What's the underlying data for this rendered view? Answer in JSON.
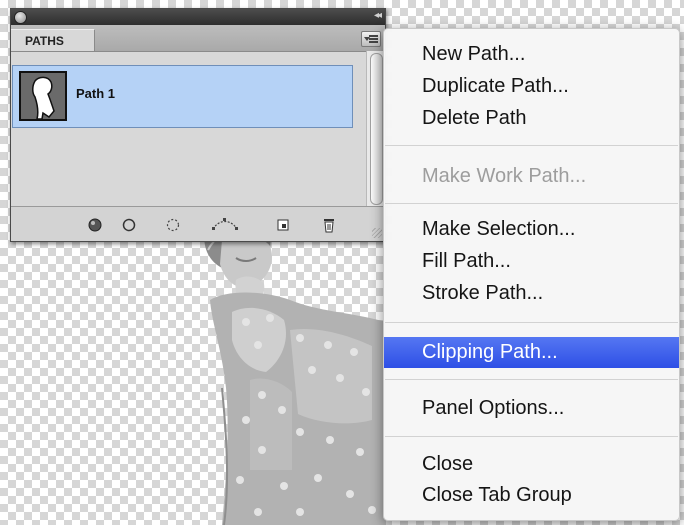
{
  "panel": {
    "tab_label": "PATHS",
    "collapse_glyph": "◂◂",
    "paths": [
      {
        "label": "Path 1",
        "selected": true
      }
    ],
    "footer_buttons": [
      {
        "icon": "fill-path-icon"
      },
      {
        "icon": "stroke-path-icon"
      },
      {
        "icon": "load-selection-icon"
      },
      {
        "icon": "make-work-path-icon"
      },
      {
        "icon": "new-path-icon"
      },
      {
        "icon": "delete-path-icon"
      }
    ]
  },
  "menu": {
    "items": [
      {
        "label": "New Path...",
        "disabled": false,
        "selected": false
      },
      {
        "label": "Duplicate Path...",
        "disabled": false,
        "selected": false
      },
      {
        "label": "Delete Path",
        "disabled": false,
        "selected": false
      },
      {
        "label": "Make Work Path...",
        "disabled": true,
        "selected": false
      },
      {
        "label": "Make Selection...",
        "disabled": false,
        "selected": false
      },
      {
        "label": "Fill Path...",
        "disabled": false,
        "selected": false
      },
      {
        "label": "Stroke Path...",
        "disabled": false,
        "selected": false
      },
      {
        "label": "Clipping Path...",
        "disabled": false,
        "selected": true
      },
      {
        "label": "Panel Options...",
        "disabled": false,
        "selected": false
      },
      {
        "label": "Close",
        "disabled": false,
        "selected": false
      },
      {
        "label": "Close Tab Group",
        "disabled": false,
        "selected": false
      }
    ],
    "highlight_color": "#3a5cf0"
  }
}
